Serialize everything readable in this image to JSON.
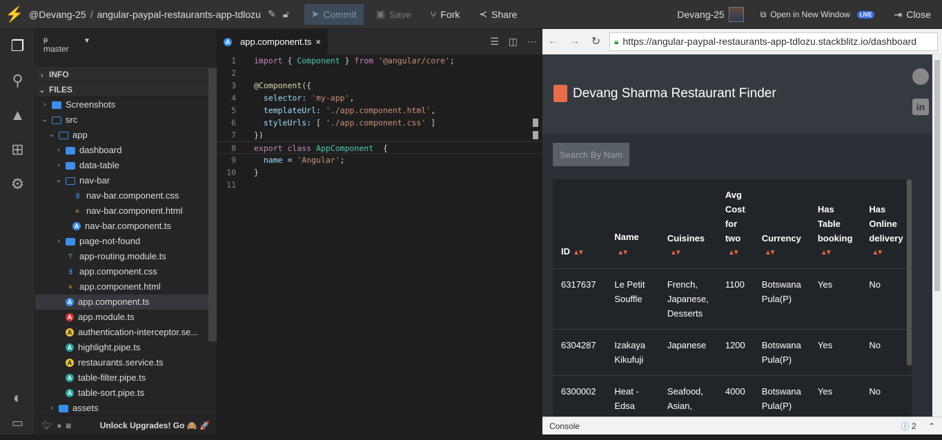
{
  "topbar": {
    "owner": "@Devang-25",
    "project": "angular-paypal-restaurants-app-tdlozu",
    "commit_label": "Commit",
    "save_label": "Save",
    "fork_label": "Fork",
    "share_label": "Share",
    "username": "Devang-25",
    "open_new_window_label": "Open in New Window",
    "live_badge": "LIVE",
    "close_label": "Close"
  },
  "sidebar": {
    "branch": "master",
    "sections": {
      "info": "INFO",
      "files": "FILES"
    },
    "tree": [
      {
        "label": "Screenshots",
        "type": "folder",
        "depth": 0,
        "open": false
      },
      {
        "label": "src",
        "type": "folder",
        "depth": 0,
        "open": true
      },
      {
        "label": "app",
        "type": "folder",
        "depth": 1,
        "open": true
      },
      {
        "label": "dashboard",
        "type": "folder",
        "depth": 2,
        "open": false
      },
      {
        "label": "data-table",
        "type": "folder",
        "depth": 2,
        "open": false
      },
      {
        "label": "nav-bar",
        "type": "folder",
        "depth": 2,
        "open": true
      },
      {
        "label": "nav-bar.component.css",
        "type": "css",
        "depth": 3
      },
      {
        "label": "nav-bar.component.html",
        "type": "html",
        "depth": 3
      },
      {
        "label": "nav-bar.component.ts",
        "type": "ts",
        "depth": 3
      },
      {
        "label": "page-not-found",
        "type": "folder",
        "depth": 2,
        "open": false
      },
      {
        "label": "app-routing.module.ts",
        "type": "route",
        "depth": 2
      },
      {
        "label": "app.component.css",
        "type": "css",
        "depth": 2
      },
      {
        "label": "app.component.html",
        "type": "html",
        "depth": 2
      },
      {
        "label": "app.component.ts",
        "type": "ts",
        "depth": 2,
        "selected": true
      },
      {
        "label": "app.module.ts",
        "type": "mod",
        "depth": 2
      },
      {
        "label": "authentication-interceptor.se...",
        "type": "svc",
        "depth": 2
      },
      {
        "label": "highlight.pipe.ts",
        "type": "pipe",
        "depth": 2
      },
      {
        "label": "restaurants.service.ts",
        "type": "svc",
        "depth": 2
      },
      {
        "label": "table-filter.pipe.ts",
        "type": "pipe",
        "depth": 2
      },
      {
        "label": "table-sort.pipe.ts",
        "type": "pipe",
        "depth": 2
      },
      {
        "label": "assets",
        "type": "folder",
        "depth": 1,
        "open": false
      }
    ],
    "footer": "Unlock Upgrades! Go 🙈 🚀"
  },
  "editor": {
    "tab_label": "app.component.ts",
    "lines": [
      {
        "n": "1",
        "code": [
          [
            "kw",
            "import"
          ],
          [
            "pl",
            " { "
          ],
          [
            "cls",
            "Component"
          ],
          [
            "pl",
            " } "
          ],
          [
            "kw",
            "from"
          ],
          [
            "pl",
            " "
          ],
          [
            "str",
            "'@angular/core'"
          ],
          [
            "pl",
            ";"
          ]
        ]
      },
      {
        "n": "2",
        "code": []
      },
      {
        "n": "3",
        "code": [
          [
            "dec",
            "@Component"
          ],
          [
            "pl",
            "({"
          ]
        ]
      },
      {
        "n": "4",
        "code": [
          [
            "pl",
            "  "
          ],
          [
            "prop",
            "selector"
          ],
          [
            "pl",
            ": "
          ],
          [
            "str",
            "'my-app'"
          ],
          [
            "pl",
            ","
          ]
        ]
      },
      {
        "n": "5",
        "code": [
          [
            "pl",
            "  "
          ],
          [
            "prop",
            "templateUrl"
          ],
          [
            "pl",
            ": "
          ],
          [
            "str",
            "'./app.component.html'"
          ],
          [
            "pl",
            ","
          ]
        ]
      },
      {
        "n": "6",
        "code": [
          [
            "pl",
            "  "
          ],
          [
            "prop",
            "styleUrls"
          ],
          [
            "pl",
            ": [ "
          ],
          [
            "str",
            "'./app.component.css'"
          ],
          [
            "pl",
            " ]"
          ]
        ]
      },
      {
        "n": "7",
        "code": [
          [
            "pl",
            "})"
          ]
        ]
      },
      {
        "n": "8",
        "code": [
          [
            "kw",
            "export"
          ],
          [
            "pl",
            " "
          ],
          [
            "kw",
            "class"
          ],
          [
            "pl",
            " "
          ],
          [
            "cls",
            "AppComponent"
          ],
          [
            "pl",
            "  {"
          ]
        ],
        "current": true
      },
      {
        "n": "9",
        "code": [
          [
            "pl",
            "  "
          ],
          [
            "id",
            "name"
          ],
          [
            "pl",
            " = "
          ],
          [
            "str",
            "'Angular'"
          ],
          [
            "pl",
            ";"
          ]
        ]
      },
      {
        "n": "10",
        "code": [
          [
            "pl",
            "}"
          ]
        ]
      },
      {
        "n": "11",
        "code": []
      }
    ]
  },
  "preview": {
    "url": "https://angular-paypal-restaurants-app-tdlozu.stackblitz.io/dashboard",
    "brand": "Devang Sharma Restaurant Finder",
    "search_placeholder": "Search By Name",
    "columns": [
      "ID",
      "Name",
      "Cuisines",
      "Avg Cost for two",
      "Currency",
      "Has Table booking",
      "Has Online delivery"
    ],
    "rows": [
      [
        "6317637",
        "Le Petit Souffle",
        "French, Japanese, Desserts",
        "1100",
        "Botswana Pula(P)",
        "Yes",
        "No"
      ],
      [
        "6304287",
        "Izakaya Kikufuji",
        "Japanese",
        "1200",
        "Botswana Pula(P)",
        "Yes",
        "No"
      ],
      [
        "6300002",
        "Heat - Edsa",
        "Seafood, Asian,",
        "4000",
        "Botswana Pula(P)",
        "Yes",
        "No"
      ]
    ],
    "console_label": "Console",
    "console_count": "2"
  }
}
